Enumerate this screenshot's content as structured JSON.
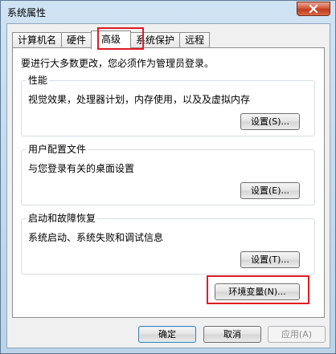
{
  "window": {
    "title": "系统属性",
    "close_icon": "close-icon"
  },
  "tabs": [
    {
      "label": "计算机名",
      "active": false
    },
    {
      "label": "硬件",
      "active": false
    },
    {
      "label": "高级",
      "active": true
    },
    {
      "label": "系统保护",
      "active": false
    },
    {
      "label": "远程",
      "active": false
    }
  ],
  "advanced": {
    "admin_note": "要进行大多数更改，您必须作为管理员登录。",
    "performance": {
      "label": "性能",
      "description": "视觉效果，处理器计划，内存使用，以及及虚拟内存",
      "button": "设置(S)..."
    },
    "user_profiles": {
      "label": "用户配置文件",
      "description": "与您登录有关的桌面设置",
      "button": "设置(E)..."
    },
    "startup_recovery": {
      "label": "启动和故障恢复",
      "description": "系统启动、系统失败和调试信息",
      "button": "设置(T)..."
    },
    "env_button": "环境变量(N)..."
  },
  "footer": {
    "ok": "确定",
    "cancel": "取消",
    "apply": "应用(A)"
  },
  "colors": {
    "highlight_box": "#e01b24",
    "title_bar": "#c2d8ec",
    "close_button": "#c0391d"
  }
}
